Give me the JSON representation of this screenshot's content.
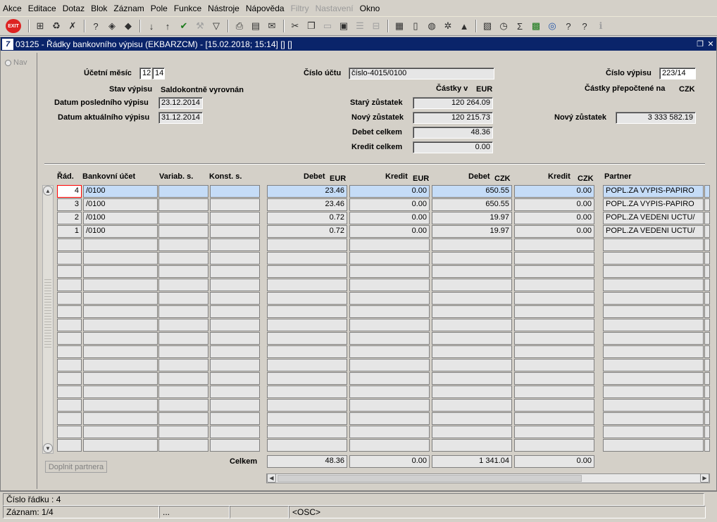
{
  "menu": [
    "Akce",
    "Editace",
    "Dotaz",
    "Blok",
    "Záznam",
    "Pole",
    "Funkce",
    "Nástroje",
    "Nápověda",
    "Filtry",
    "Nastavení",
    "Okno"
  ],
  "menu_disabled": [
    "Filtry",
    "Nastavení"
  ],
  "window": {
    "title": "03125 - Řádky bankovního výpisu (EKBARZCM) - [15.02.2018; 15:14] [] []",
    "app_icon": "7"
  },
  "toolbar": {
    "exit_label": "EXIT"
  },
  "nav": {
    "label": "Nav"
  },
  "header": {
    "ucetni_mesic_label": "Účetní měsíc",
    "ucetni_mesic_1": "12",
    "ucetni_mesic_2": "14",
    "cislo_uctu_label": "Číslo účtu",
    "cislo_uctu_value": "číslo-4015/0100",
    "cislo_vypisu_label": "Číslo výpisu",
    "cislo_vypisu_value": "223/14",
    "stav_vypisu_label": "Stav výpisu",
    "stav_vypisu_value": "Saldokontně vyrovnán",
    "castky_v_label": "Částky v",
    "castky_v_currency": "EUR",
    "castky_prepoctene_label": "Částky přepočtené na",
    "castky_prepoctene_currency": "CZK",
    "datum_posledniho_label": "Datum posledního výpisu",
    "datum_posledniho_value": "23.12.2014",
    "datum_aktualniho_label": "Datum aktuálního výpisu",
    "datum_aktualniho_value": "31.12.2014",
    "stary_zustatek_label": "Starý zůstatek",
    "stary_zustatek_value": "120 264.09",
    "novy_zustatek_label": "Nový zůstatek",
    "novy_zustatek_value": "120 215.73",
    "debet_celkem_label": "Debet celkem",
    "debet_celkem_value": "48.36",
    "kredit_celkem_label": "Kredit celkem",
    "kredit_celkem_value": "0.00",
    "novy_zustatek_czk_label": "Nový zůstatek",
    "novy_zustatek_czk_value": "3 333 582.19"
  },
  "grid": {
    "col_rad": "Řád.",
    "col_ucet": "Bankovní účet",
    "col_variab": "Variab. s.",
    "col_konst": "Konst. s.",
    "col_debet_eur": "Debet",
    "cur_debet_eur": "EUR",
    "col_kredit_eur": "Kredit",
    "cur_kredit_eur": "EUR",
    "col_debet_czk": "Debet",
    "cur_debet_czk": "CZK",
    "col_kredit_czk": "Kredit",
    "cur_kredit_czk": "CZK",
    "col_partner": "Partner",
    "rows": [
      {
        "rad": "4",
        "ucet": "/0100",
        "variab": "",
        "konst": "",
        "debet_eur": "23.46",
        "kredit_eur": "0.00",
        "debet_czk": "650.55",
        "kredit_czk": "0.00",
        "partner": "POPL.ZA VYPIS-PAPIRO"
      },
      {
        "rad": "3",
        "ucet": "/0100",
        "variab": "",
        "konst": "",
        "debet_eur": "23.46",
        "kredit_eur": "0.00",
        "debet_czk": "650.55",
        "kredit_czk": "0.00",
        "partner": "POPL.ZA VYPIS-PAPIRO"
      },
      {
        "rad": "2",
        "ucet": "/0100",
        "variab": "",
        "konst": "",
        "debet_eur": "0.72",
        "kredit_eur": "0.00",
        "debet_czk": "19.97",
        "kredit_czk": "0.00",
        "partner": "POPL.ZA VEDENI UCTU/"
      },
      {
        "rad": "1",
        "ucet": "/0100",
        "variab": "",
        "konst": "",
        "debet_eur": "0.72",
        "kredit_eur": "0.00",
        "debet_czk": "19.97",
        "kredit_czk": "0.00",
        "partner": "POPL.ZA VEDENI UCTU/"
      }
    ]
  },
  "totals": {
    "label": "Celkem",
    "debet_eur": "48.36",
    "kredit_eur": "0.00",
    "debet_czk": "1 341.04",
    "kredit_czk": "0.00"
  },
  "doplnit_button": "Doplnit partnera",
  "status": {
    "cislo_radku": "Číslo řádku : 4",
    "zaznam": "Záznam: 1/4",
    "dots": "...",
    "osc": "<OSC>"
  }
}
